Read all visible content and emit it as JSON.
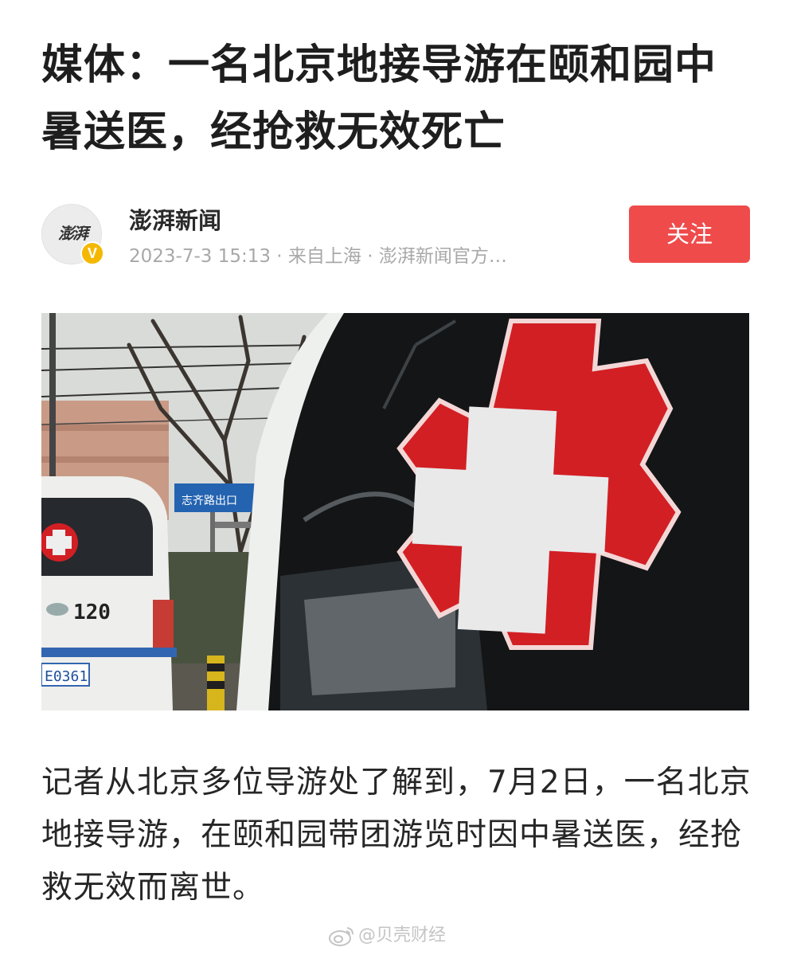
{
  "article": {
    "title": "媒体：一名北京地接导游在颐和园中暑送医，经抢救无效死亡",
    "body": "记者从北京多位导游处了解到，7月2日，一名北京地接导游，在颐和园带团游览时因中暑送医，经抢救无效而离世。"
  },
  "author": {
    "avatar_text": "澎湃",
    "verified_badge": "V",
    "name": "澎湃新闻",
    "meta": "2023-7-3 15:13 · 来自上海 · 澎湃新闻官方…",
    "follow_label": "关注"
  },
  "photo": {
    "ambulance_number": "120",
    "plate": "E0361",
    "sign_text": "志齐路出口"
  },
  "watermark": {
    "text": "@贝壳财经",
    "icon": "weibo-icon"
  },
  "colors": {
    "follow_button": "#ef4b4b",
    "verified_badge": "#f5b800",
    "red_cross": "#d21f24"
  }
}
